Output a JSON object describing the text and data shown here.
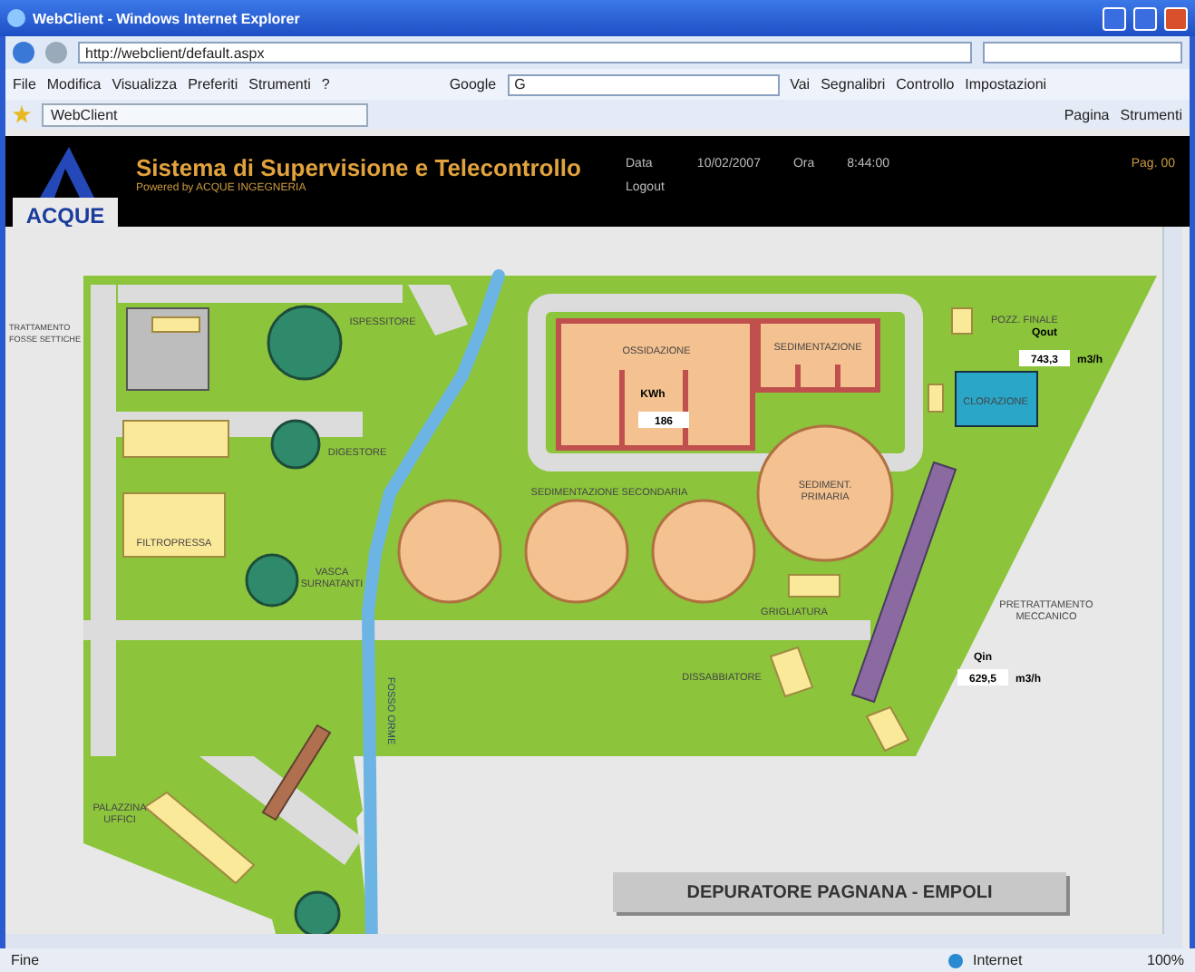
{
  "browser": {
    "title": "WebClient - Windows Internet Explorer",
    "address": "http://webclient/default.aspx",
    "menu": [
      "File",
      "Modifica",
      "Visualizza",
      "Preferiti",
      "Strumenti",
      "?"
    ],
    "search_engine": "Google",
    "search_placeholder": "G",
    "toolbar": [
      "Vai",
      "Segnalibri",
      "Controllo",
      "Impostazioni"
    ],
    "tab": "WebClient",
    "page_tools": [
      "Pagina",
      "Strumenti"
    ],
    "status": "Fine",
    "zone": "Internet",
    "zoom": "100%"
  },
  "header": {
    "logo": "ACQUE",
    "title": "Sistema di Supervisione e Telecontrollo",
    "subtitle": "Powered by ACQUE INGEGNERIA",
    "fields": [
      {
        "label": "Data",
        "value": "10/02/2007"
      },
      {
        "label": "Ora",
        "value": "8:44:00"
      }
    ],
    "logout": "Logout",
    "page": "Pag. 00"
  },
  "map": {
    "labels": [
      {
        "lines": [
          "TRATTAMENTO",
          "FOSSE SETTICHE"
        ]
      },
      {
        "lines": [
          "ISPESSITORE"
        ]
      },
      {
        "lines": [
          "DIGESTORE"
        ]
      },
      {
        "lines": [
          "FILTROPRESSA"
        ]
      },
      {
        "lines": [
          "VASCA",
          "SURNATANTI"
        ]
      },
      {
        "lines": [
          "OSSIDAZIONE"
        ]
      },
      {
        "lines": [
          "SEDIMENTAZIONE"
        ]
      },
      {
        "lines": [
          "SEDIMENTAZIONE SECONDARIA"
        ]
      },
      {
        "lines": [
          "SEDIMENT.",
          "PRIMARIA"
        ]
      },
      {
        "lines": [
          "POZZ. FINALE"
        ]
      },
      {
        "lines": [
          "CLORAZIONE"
        ]
      },
      {
        "lines": [
          "GRIGLIATURA"
        ]
      },
      {
        "lines": [
          "PRETRATTAMENTO",
          "MECCANICO"
        ]
      },
      {
        "lines": [
          "DISSABBIATORE"
        ]
      },
      {
        "lines": [
          "PALAZZINA",
          "UFFICI"
        ]
      },
      {
        "lines": [
          "FOSSO ORME"
        ]
      }
    ],
    "readings": [
      {
        "label": "KWh",
        "value": "186"
      },
      {
        "label": "Qout",
        "value": "743,3",
        "unit": "m3/h"
      },
      {
        "label": "Qin",
        "value": "629,5",
        "unit": "m3/h"
      }
    ],
    "title": "DEPURATORE PAGNANA - EMPOLI"
  }
}
